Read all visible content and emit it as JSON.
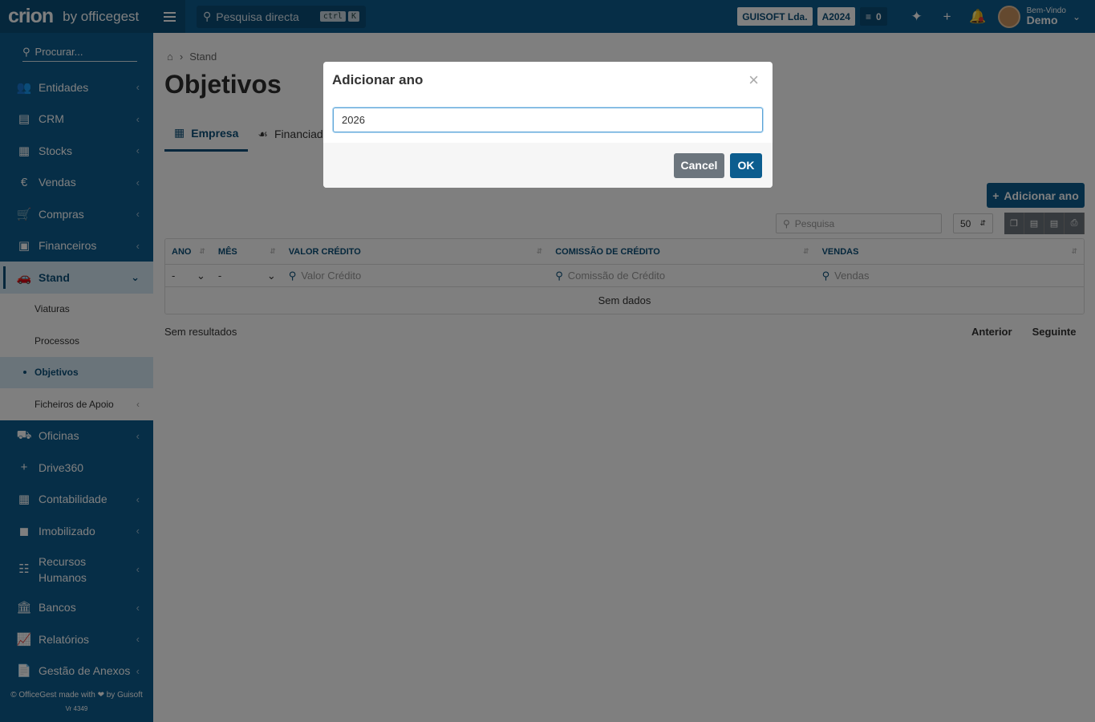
{
  "topbar": {
    "logo": "crion",
    "by": "by officegest",
    "direct_search": "Pesquisa directa",
    "kbd1": "ctrl",
    "kbd2": "K",
    "company": "GUISOFT Lda.",
    "year": "A2024",
    "tasks_count": "0",
    "welcome": "Bem-Vindo",
    "user": "Demo"
  },
  "sidebar": {
    "search_placeholder": "Procurar...",
    "items": [
      {
        "label": "Entidades",
        "icon": "users-icon"
      },
      {
        "label": "CRM",
        "icon": "crm-icon"
      },
      {
        "label": "Stocks",
        "icon": "stocks-icon"
      },
      {
        "label": "Vendas",
        "icon": "euro-icon"
      },
      {
        "label": "Compras",
        "icon": "cart-icon"
      },
      {
        "label": "Financeiros",
        "icon": "money-icon"
      },
      {
        "label": "Stand",
        "icon": "car-icon"
      },
      {
        "label": "Oficinas",
        "icon": "car-front-icon"
      },
      {
        "label": "Drive360",
        "icon": "plus-icon"
      },
      {
        "label": "Contabilidade",
        "icon": "calculator-icon"
      },
      {
        "label": "Imobilizado",
        "icon": "boxes-icon"
      },
      {
        "label": "Recursos Humanos",
        "icon": "org-chart-icon"
      },
      {
        "label": "Bancos",
        "icon": "bank-icon"
      },
      {
        "label": "Relatórios",
        "icon": "chart-icon"
      },
      {
        "label": "Gestão de Anexos",
        "icon": "file-icon"
      }
    ],
    "sub_items": [
      "Viaturas",
      "Processos",
      "Objetivos",
      "Ficheiros de Apoio"
    ],
    "footer": "© OfficeGest made with ❤ by Guisoft",
    "version": "Vr 4349"
  },
  "main": {
    "breadcrumb": "Stand",
    "title": "Objetivos",
    "tabs": [
      "Empresa",
      "Financiad"
    ],
    "add_year": "Adicionar ano",
    "search_placeholder": "Pesquisa",
    "page_size": "50",
    "columns": [
      "ANO",
      "MÊS",
      "VALOR CRÉDITO",
      "COMISSÃO DE CRÉDITO",
      "VENDAS"
    ],
    "filters": [
      "-",
      "-",
      "Valor Crédito",
      "Comissão de Crédito",
      "Vendas"
    ],
    "no_data": "Sem dados",
    "no_results": "Sem resultados",
    "prev": "Anterior",
    "next": "Seguinte"
  },
  "modal": {
    "title": "Adicionar ano",
    "value": "2026",
    "cancel": "Cancel",
    "ok": "OK"
  }
}
